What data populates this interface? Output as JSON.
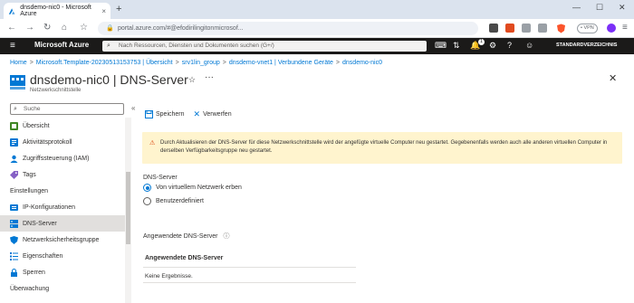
{
  "browser": {
    "tab_title": "dnsdemo-nic0 - Microsoft Azure",
    "tab_close": "×",
    "new_tab": "+",
    "url": "portal.azure.com/#@efodirilingitonmicrosof...",
    "vpn_label": "• VPN",
    "window_min": "—",
    "window_max": "☐",
    "window_close": "✕",
    "back": "←",
    "forward": "→",
    "reload": "↻",
    "home": "⌂",
    "bookmark": "☆",
    "lock": "🔒",
    "menu": "≡"
  },
  "azure": {
    "brand": "Microsoft Azure",
    "search_placeholder": "Nach Ressourcen, Diensten und Dokumenten suchen (G+/)",
    "notification_count": "1",
    "directory": "STANDARDVERZEICHNIS",
    "hamburger": "≡"
  },
  "breadcrumb": [
    "Home",
    "Microsoft.Template-20230513153753 | Übersicht",
    "srv1lin_group",
    "dnsdemo-vnet1 | Verbundene Geräte",
    "dnsdemo-nic0"
  ],
  "breadcrumb_sep": ">",
  "page": {
    "title": "dnsdemo-nic0 | DNS-Server",
    "subtitle": "Netzwerkschnittstelle",
    "pin": "☆",
    "more": "···",
    "close": "✕"
  },
  "sidebar": {
    "search_placeholder": "Suche",
    "collapse": "«",
    "items": [
      {
        "label": "Übersicht",
        "icon": "overview-icon",
        "color": "#3f8624"
      },
      {
        "label": "Aktivitätsprotokoll",
        "icon": "activity-log-icon",
        "color": "#0078d4"
      },
      {
        "label": "Zugriffssteuerung (IAM)",
        "icon": "iam-icon",
        "color": "#0078d4"
      },
      {
        "label": "Tags",
        "icon": "tag-icon",
        "color": "#8661c5"
      }
    ],
    "section_settings": "Einstellungen",
    "settings_items": [
      {
        "label": "IP-Konfigurationen",
        "icon": "ip-config-icon",
        "color": "#0078d4"
      },
      {
        "label": "DNS-Server",
        "icon": "dns-server-icon",
        "color": "#0078d4",
        "selected": true
      },
      {
        "label": "Netzwerksicherheitsgruppe",
        "icon": "nsg-icon",
        "color": "#0078d4"
      },
      {
        "label": "Eigenschaften",
        "icon": "properties-icon",
        "color": "#0078d4"
      },
      {
        "label": "Sperren",
        "icon": "lock-icon",
        "color": "#0078d4"
      }
    ],
    "section_monitoring": "Überwachung"
  },
  "toolbar": {
    "save_label": "Speichern",
    "discard_label": "Verwerfen"
  },
  "warning": {
    "text": "Durch Aktualisieren der DNS-Server für diese Netzwerkschnittstelle wird der angefügte virtuelle Computer neu gestartet. Gegebenenfalls werden auch alle anderen virtuellen Computer in derselben Verfügbarkeitsgruppe neu gestartet."
  },
  "dns": {
    "label": "DNS-Server",
    "option_inherit": "Von virtuellem Netzwerk erben",
    "option_custom": "Benutzerdefiniert",
    "selected": "inherit"
  },
  "applied": {
    "label": "Angewendete DNS-Server",
    "info": "ⓘ",
    "column": "Angewendete DNS-Server",
    "empty": "Keine Ergebnisse."
  }
}
